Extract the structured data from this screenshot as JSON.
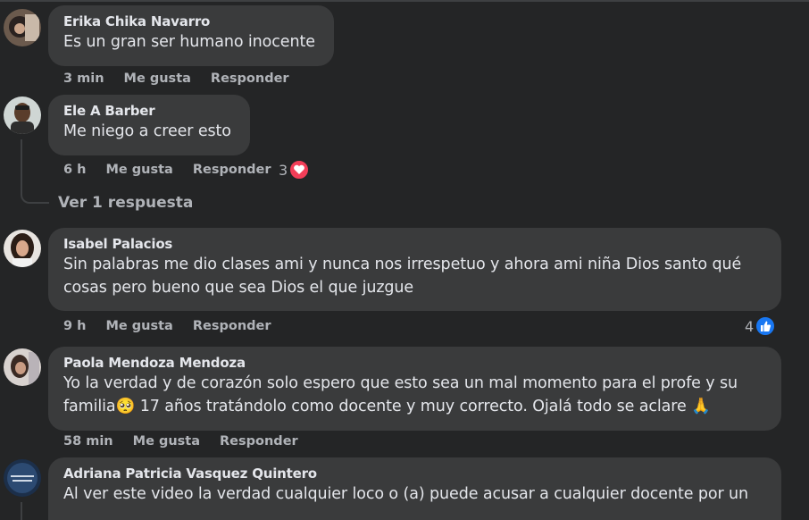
{
  "comments": [
    {
      "author": "Erika Chika Navarro",
      "text": "Es un gran ser humano inocente",
      "time": "3 min",
      "like_label": "Me gusta",
      "reply_label": "Responder"
    },
    {
      "author": "Ele A Barber",
      "text": "Me niego a creer esto",
      "time": "6 h",
      "like_label": "Me gusta",
      "reply_label": "Responder",
      "reaction_count": "3",
      "reaction_type": "love-icon",
      "view_replies": "Ver 1 respuesta"
    },
    {
      "author": "Isabel Palacios",
      "text_line1": "Sin palabras me dio clases ami y nunca nos irrespetuo y ahora ami niña Dios santo qué",
      "text_line2": "cosas pero bueno que sea Dios el que juzgue",
      "time": "9 h",
      "like_label": "Me gusta",
      "reply_label": "Responder",
      "reaction_count": "4",
      "reaction_type": "like-icon"
    },
    {
      "author": "Paola Mendoza Mendoza",
      "text_line1": "Yo la verdad y de corazón solo espero que esto sea un mal momento para el profe y su",
      "text_line2": "familia🥺 17 años tratándolo como docente y muy correcto. Ojalá todo se aclare 🙏",
      "time": "58 min",
      "like_label": "Me gusta",
      "reply_label": "Responder"
    },
    {
      "author": "Adriana Patricia Vasquez Quintero",
      "text_line1": "Al ver este video la verdad cualquier loco o (a) puede acusar a cualquier docente por un"
    }
  ],
  "colors": {
    "background": "#242526",
    "bubble": "#3a3b3c",
    "love": "#f33e58",
    "like": "#1877f2"
  }
}
